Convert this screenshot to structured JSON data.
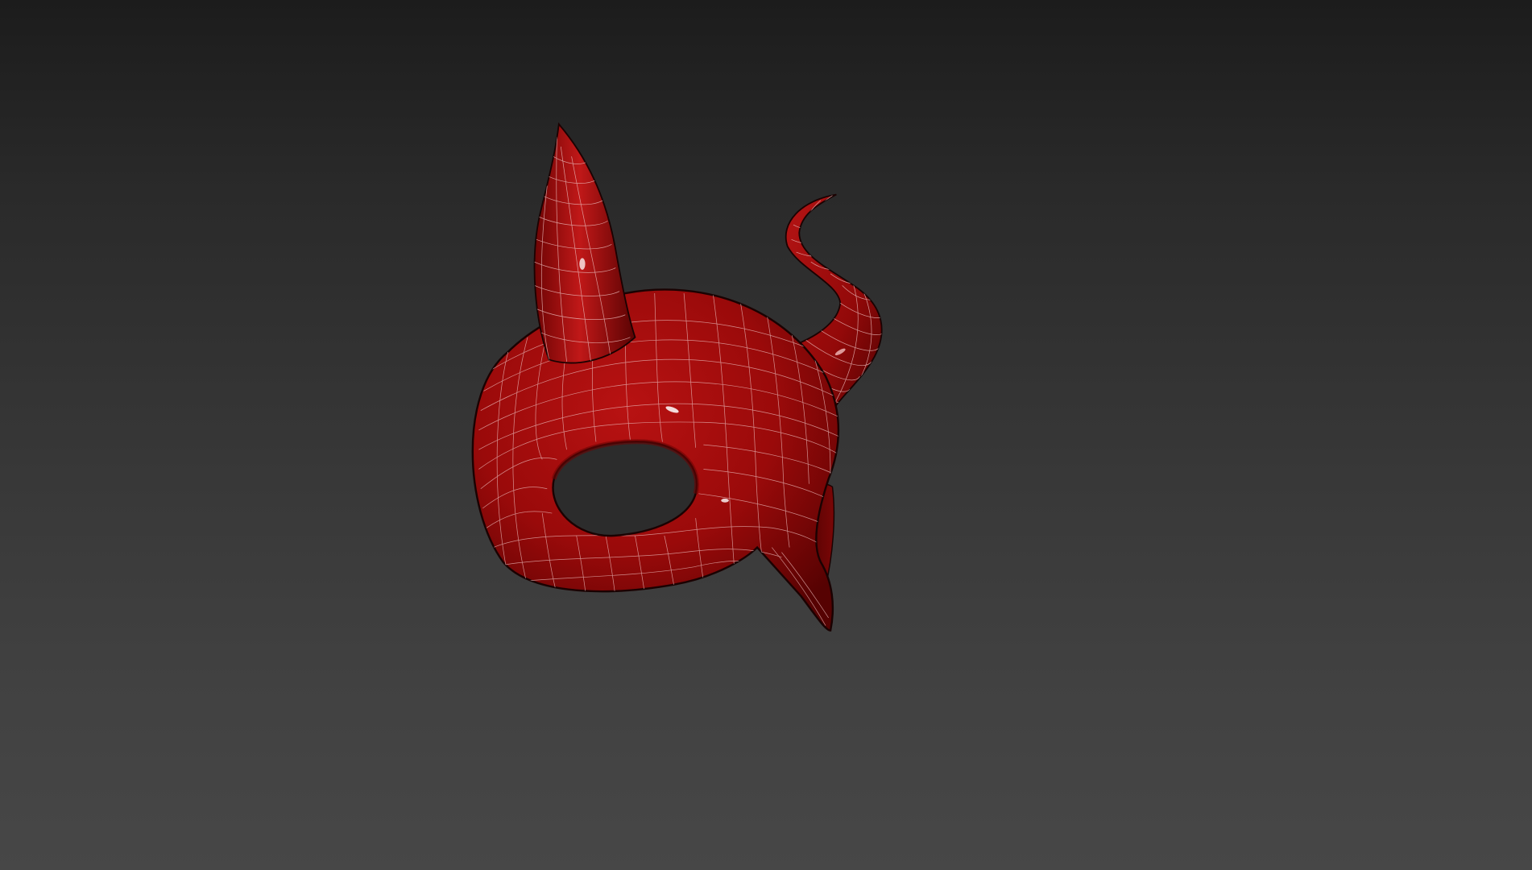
{
  "viewport": {
    "background_top": "#1c1c1c",
    "background_bottom": "#474747"
  },
  "model": {
    "object": "devil-mask",
    "shading": "smooth-highlights-with-wireframe",
    "surface_color": "#a50d0d",
    "shadow_color": "#5a0303",
    "highlight_color": "#e23a3a",
    "wire_color": "#e9b9b9",
    "outline_color": "#1a0202"
  }
}
